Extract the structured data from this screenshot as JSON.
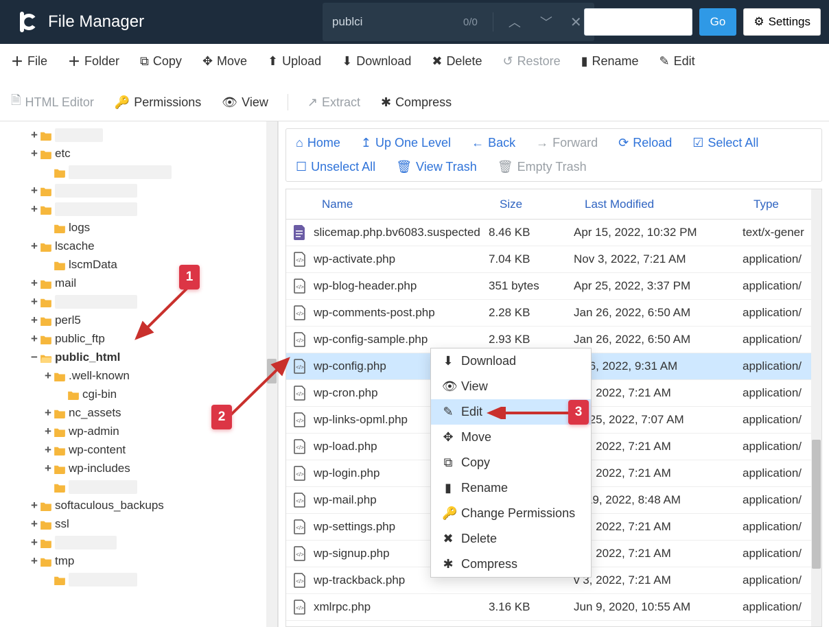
{
  "header": {
    "title": "File Manager",
    "search_text": "publci",
    "search_count": "0/0",
    "go": "Go",
    "settings": "Settings"
  },
  "toolbar": {
    "file": "File",
    "folder": "Folder",
    "copy": "Copy",
    "move": "Move",
    "upload": "Upload",
    "download": "Download",
    "delete": "Delete",
    "restore": "Restore",
    "rename": "Rename",
    "edit": "Edit",
    "html_editor": "HTML Editor",
    "permissions": "Permissions",
    "view": "View",
    "extract": "Extract",
    "compress": "Compress"
  },
  "nav": {
    "home": "Home",
    "up": "Up One Level",
    "back": "Back",
    "forward": "Forward",
    "reload": "Reload",
    "select_all": "Select All",
    "unselect_all": "Unselect All",
    "view_trash": "View Trash",
    "empty_trash": "Empty Trash"
  },
  "columns": {
    "name": "Name",
    "size": "Size",
    "modified": "Last Modified",
    "type": "Type"
  },
  "tree": [
    {
      "toggle": "+",
      "label": "",
      "blur": true,
      "w": 70
    },
    {
      "toggle": "+",
      "label": "etc"
    },
    {
      "toggle": "",
      "label": "",
      "blur": true,
      "sub": 1,
      "w": 150
    },
    {
      "toggle": "+",
      "label": "",
      "blur": true,
      "w": 120
    },
    {
      "toggle": "+",
      "label": "",
      "blur": true,
      "w": 120
    },
    {
      "toggle": "",
      "label": "logs",
      "sub": 1
    },
    {
      "toggle": "+",
      "label": "lscache"
    },
    {
      "toggle": "",
      "label": "lscmData",
      "sub": 1
    },
    {
      "toggle": "+",
      "label": "mail"
    },
    {
      "toggle": "+",
      "label": "",
      "blur": true,
      "w": 120
    },
    {
      "toggle": "+",
      "label": "perl5"
    },
    {
      "toggle": "+",
      "label": "public_ftp"
    },
    {
      "toggle": "−",
      "label": "public_html",
      "bold": true,
      "open": true
    },
    {
      "toggle": "+",
      "label": ".well-known",
      "sub": 1
    },
    {
      "toggle": "",
      "label": "cgi-bin",
      "sub": 2
    },
    {
      "toggle": "+",
      "label": "nc_assets",
      "sub": 1
    },
    {
      "toggle": "+",
      "label": "wp-admin",
      "sub": 1
    },
    {
      "toggle": "+",
      "label": "wp-content",
      "sub": 1
    },
    {
      "toggle": "+",
      "label": "wp-includes",
      "sub": 1
    },
    {
      "toggle": "",
      "label": "",
      "blur": true,
      "sub": 1,
      "w": 100
    },
    {
      "toggle": "+",
      "label": "softaculous_backups"
    },
    {
      "toggle": "+",
      "label": "ssl"
    },
    {
      "toggle": "+",
      "label": "",
      "blur": true,
      "w": 90
    },
    {
      "toggle": "+",
      "label": "tmp"
    },
    {
      "toggle": "",
      "label": "",
      "blur": true,
      "sub": 1,
      "w": 100
    }
  ],
  "files": [
    {
      "icon": "doc",
      "name": "slicemap.php.bv6083.suspected",
      "size": "8.46 KB",
      "mod": "Apr 15, 2022, 10:32 PM",
      "type": "text/x-gener"
    },
    {
      "icon": "php",
      "name": "wp-activate.php",
      "size": "7.04 KB",
      "mod": "Nov 3, 2022, 7:21 AM",
      "type": "application/"
    },
    {
      "icon": "php",
      "name": "wp-blog-header.php",
      "size": "351 bytes",
      "mod": "Apr 25, 2022, 3:37 PM",
      "type": "application/"
    },
    {
      "icon": "php",
      "name": "wp-comments-post.php",
      "size": "2.28 KB",
      "mod": "Jan 26, 2022, 6:50 AM",
      "type": "application/"
    },
    {
      "icon": "php",
      "name": "wp-config-sample.php",
      "size": "2.93 KB",
      "mod": "Jan 26, 2022, 6:50 AM",
      "type": "application/"
    },
    {
      "icon": "php",
      "name": "wp-config.php",
      "size": "",
      "mod": "c 26, 2022, 9:31 AM",
      "type": "application/",
      "sel": true
    },
    {
      "icon": "php",
      "name": "wp-cron.php",
      "size": "",
      "mod": "v 3, 2022, 7:21 AM",
      "type": "application/"
    },
    {
      "icon": "php",
      "name": "wp-links-opml.php",
      "size": "",
      "mod": "ay 25, 2022, 7:07 AM",
      "type": "application/"
    },
    {
      "icon": "php",
      "name": "wp-load.php",
      "size": "",
      "mod": "v 3, 2022, 7:21 AM",
      "type": "application/"
    },
    {
      "icon": "php",
      "name": "wp-login.php",
      "size": "",
      "mod": "v 3, 2022, 7:21 AM",
      "type": "application/"
    },
    {
      "icon": "php",
      "name": "wp-mail.php",
      "size": "",
      "mod": "ct 19, 2022, 8:48 AM",
      "type": "application/"
    },
    {
      "icon": "php",
      "name": "wp-settings.php",
      "size": "",
      "mod": "v 3, 2022, 7:21 AM",
      "type": "application/"
    },
    {
      "icon": "php",
      "name": "wp-signup.php",
      "size": "",
      "mod": "v 3, 2022, 7:21 AM",
      "type": "application/"
    },
    {
      "icon": "php",
      "name": "wp-trackback.php",
      "size": "",
      "mod": "v 3, 2022, 7:21 AM",
      "type": "application/"
    },
    {
      "icon": "php",
      "name": "xmlrpc.php",
      "size": "3.16 KB",
      "mod": "Jun 9, 2020, 10:55 AM",
      "type": "application/"
    }
  ],
  "context": [
    {
      "icon": "⬇",
      "label": "Download"
    },
    {
      "icon": "👁",
      "label": "View"
    },
    {
      "icon": "✎",
      "label": "Edit",
      "hover": true
    },
    {
      "icon": "✥",
      "label": "Move"
    },
    {
      "icon": "⧉",
      "label": "Copy"
    },
    {
      "icon": "▮",
      "label": "Rename"
    },
    {
      "icon": "🔑",
      "label": "Change Permissions"
    },
    {
      "icon": "✖",
      "label": "Delete"
    },
    {
      "icon": "✱",
      "label": "Compress"
    }
  ],
  "callouts": {
    "c1": "1",
    "c2": "2",
    "c3": "3"
  }
}
